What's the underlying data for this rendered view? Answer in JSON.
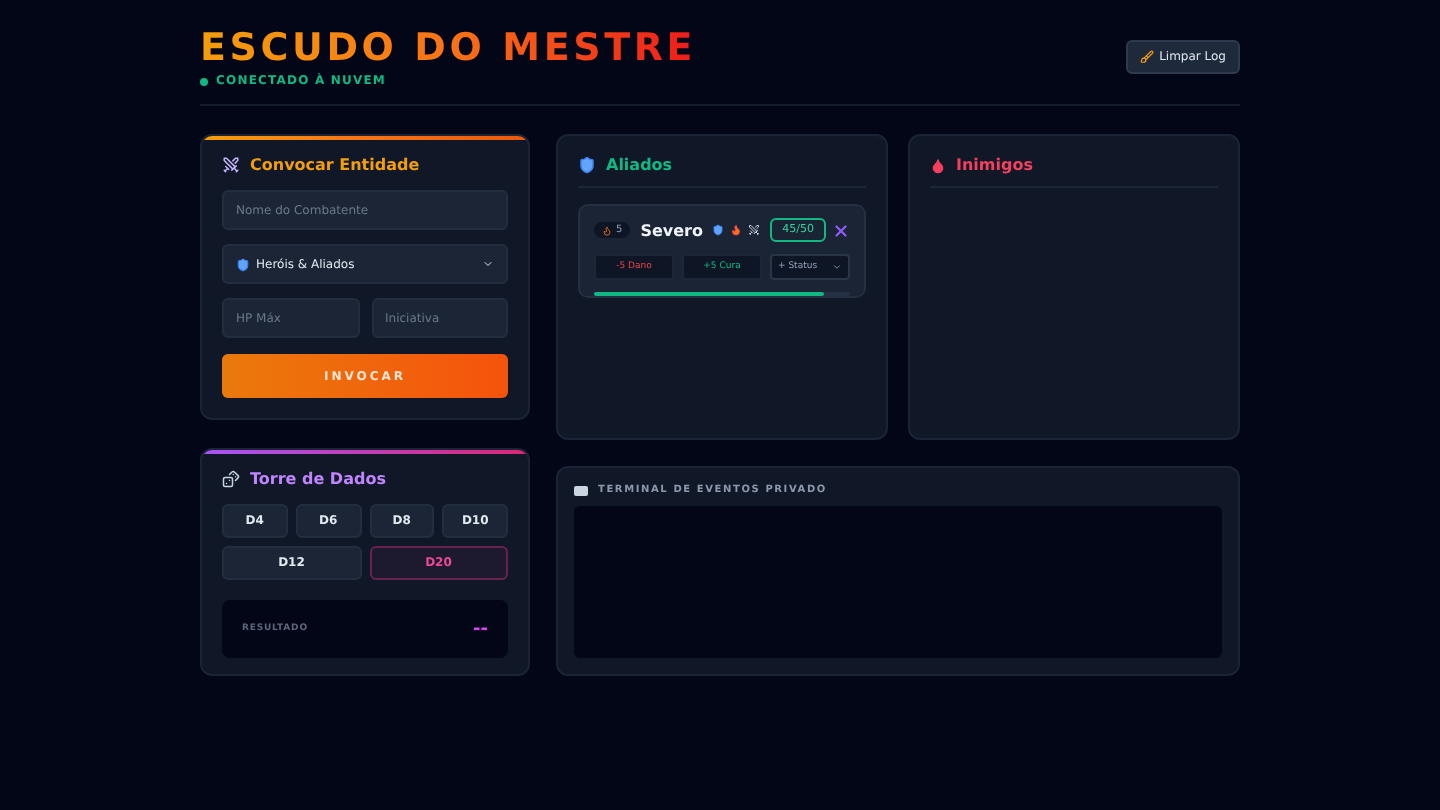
{
  "header": {
    "title": "ESCUDO DO MESTRE",
    "status": "CONECTADO À NUVEM",
    "connected": true,
    "clear_button": "Limpar Log"
  },
  "summon": {
    "title": "Convocar Entidade",
    "name_placeholder": "Nome do Combatente",
    "type_select": "Heróis & Aliados",
    "hp_placeholder": "HP Máx",
    "initiative_placeholder": "Iniciativa",
    "submit": "INVOCAR"
  },
  "allies": {
    "title": "Aliados",
    "combatants": [
      {
        "initiative": "5",
        "name": "Severo",
        "hp": "45/50",
        "level": 0.9,
        "damage": "-5 Dano",
        "heal": "+5 Cura",
        "status_select": "+ Status"
      }
    ]
  },
  "enemies": {
    "title": "Inimigos"
  },
  "dice": {
    "title": "Torre de Dados",
    "buttons": [
      {
        "label": "D4",
        "selected": false
      },
      {
        "label": "D6",
        "selected": false
      },
      {
        "label": "D8",
        "selected": false
      },
      {
        "label": "D10",
        "selected": false
      },
      {
        "label": "D12",
        "selected": false
      },
      {
        "label": "D20",
        "selected": true
      }
    ],
    "result_label": "RESULTADO",
    "result": "--"
  },
  "terminal": {
    "title": "TERMINAL DE EVENTOS PRIVADO"
  }
}
